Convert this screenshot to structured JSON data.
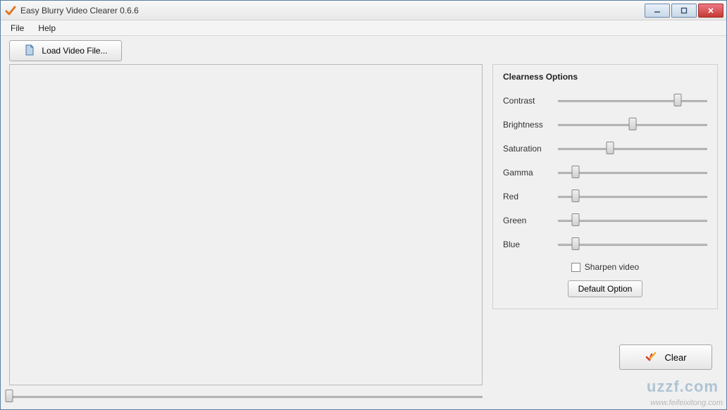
{
  "window": {
    "title": "Easy Blurry Video Clearer 0.6.6"
  },
  "menu": {
    "file": "File",
    "help": "Help"
  },
  "toolbar": {
    "load_label": "Load Video File..."
  },
  "options": {
    "title": "Clearness Options",
    "sliders": [
      {
        "label": "Contrast",
        "value": 80
      },
      {
        "label": "Brightness",
        "value": 50
      },
      {
        "label": "Saturation",
        "value": 35
      },
      {
        "label": "Gamma",
        "value": 12
      },
      {
        "label": "Red",
        "value": 12
      },
      {
        "label": "Green",
        "value": 12
      },
      {
        "label": "Blue",
        "value": 12
      }
    ],
    "sharpen_label": "Sharpen video",
    "sharpen_checked": false,
    "default_btn": "Default Option"
  },
  "progress": {
    "value": 0
  },
  "actions": {
    "clear_label": "Clear"
  },
  "watermark": {
    "logo": "uzzf.com",
    "url": "www.feifeixitong.com"
  }
}
